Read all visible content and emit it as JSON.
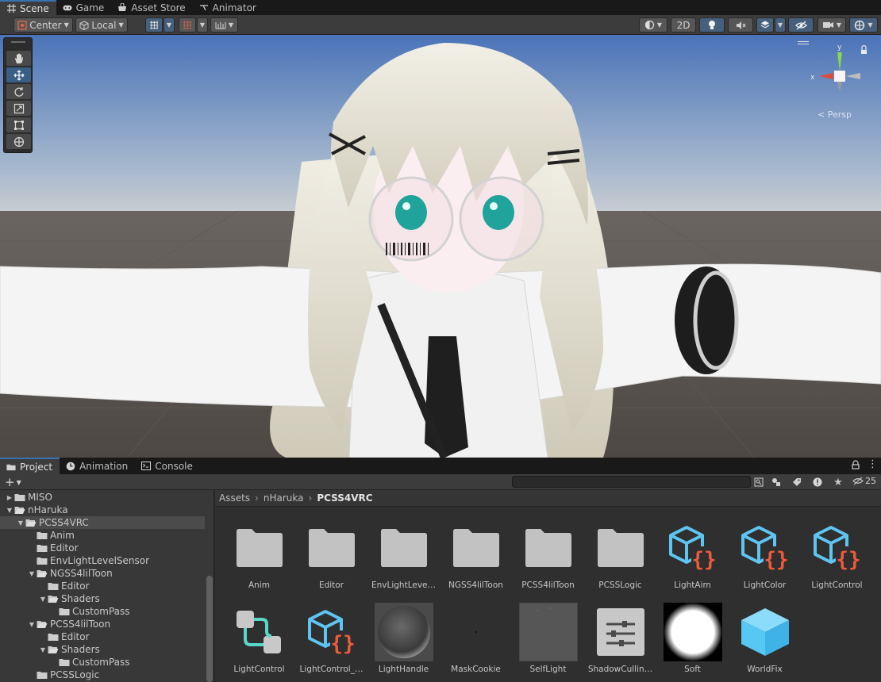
{
  "top_tabs": [
    {
      "label": "Scene",
      "icon": "grid-icon",
      "active": true
    },
    {
      "label": "Game",
      "icon": "gamepad-icon",
      "active": false
    },
    {
      "label": "Asset Store",
      "icon": "store-icon",
      "active": false
    },
    {
      "label": "Animator",
      "icon": "animator-icon",
      "active": false
    }
  ],
  "scene_toolbar": {
    "pivot_mode": "Center",
    "pivot_rotation": "Local",
    "mode_2d": "2D"
  },
  "scene_view": {
    "persp_label": "Persp",
    "gizmo_axes": {
      "x": "x",
      "y": "y"
    }
  },
  "bottom_tabs": [
    {
      "label": "Project",
      "icon": "folder-icon",
      "active": true
    },
    {
      "label": "Animation",
      "icon": "clock-icon",
      "active": false
    },
    {
      "label": "Console",
      "icon": "console-icon",
      "active": false
    }
  ],
  "project_toolbar": {
    "search_placeholder": "",
    "hidden_count": "25"
  },
  "tree": [
    {
      "label": "MISO",
      "depth": 1,
      "expanded": false,
      "selected": false
    },
    {
      "label": "nHaruka",
      "depth": 1,
      "expanded": true,
      "selected": false
    },
    {
      "label": "PCSS4VRC",
      "depth": 2,
      "expanded": true,
      "selected": true
    },
    {
      "label": "Anim",
      "depth": 3,
      "expanded": null,
      "selected": false
    },
    {
      "label": "Editor",
      "depth": 3,
      "expanded": null,
      "selected": false
    },
    {
      "label": "EnvLightLevelSensor",
      "depth": 3,
      "expanded": null,
      "selected": false
    },
    {
      "label": "NGSS4lilToon",
      "depth": 3,
      "expanded": true,
      "selected": false
    },
    {
      "label": "Editor",
      "depth": 4,
      "expanded": null,
      "selected": false
    },
    {
      "label": "Shaders",
      "depth": 4,
      "expanded": true,
      "selected": false
    },
    {
      "label": "CustomPass",
      "depth": 5,
      "expanded": null,
      "selected": false
    },
    {
      "label": "PCSS4lilToon",
      "depth": 3,
      "expanded": true,
      "selected": false
    },
    {
      "label": "Editor",
      "depth": 4,
      "expanded": null,
      "selected": false
    },
    {
      "label": "Shaders",
      "depth": 4,
      "expanded": true,
      "selected": false
    },
    {
      "label": "CustomPass",
      "depth": 5,
      "expanded": null,
      "selected": false
    },
    {
      "label": "PCSSLogic",
      "depth": 3,
      "expanded": null,
      "selected": false
    }
  ],
  "breadcrumb": [
    "Assets",
    "nHaruka",
    "PCSS4VRC"
  ],
  "assets": [
    {
      "label": "Anim",
      "kind": "folder"
    },
    {
      "label": "Editor",
      "kind": "folder"
    },
    {
      "label": "EnvLightLeve…",
      "kind": "folder"
    },
    {
      "label": "NGSS4lilToon",
      "kind": "folder"
    },
    {
      "label": "PCSS4lilToon",
      "kind": "folder"
    },
    {
      "label": "PCSSLogic",
      "kind": "folder"
    },
    {
      "label": "LightAim",
      "kind": "script"
    },
    {
      "label": "LightColor",
      "kind": "script"
    },
    {
      "label": "LightControl",
      "kind": "script"
    },
    {
      "label": "LightControl",
      "kind": "graph"
    },
    {
      "label": "LightControl_…",
      "kind": "script"
    },
    {
      "label": "LightHandle",
      "kind": "material"
    },
    {
      "label": "MaskCookie",
      "kind": "texture-dark"
    },
    {
      "label": "SelfLight",
      "kind": "texture-grey"
    },
    {
      "label": "ShadowCullin…",
      "kind": "settings"
    },
    {
      "label": "Soft",
      "kind": "texture-soft"
    },
    {
      "label": "WorldFix",
      "kind": "prefab"
    }
  ],
  "colors": {
    "accent": "#3a72b0",
    "script_cube": "#5ec4f2",
    "script_braces": "#f05a3a",
    "prefab": "#57c8f4",
    "graph": "#59d8c8",
    "sky_top": "#4a73b8",
    "ground": "#57524c"
  }
}
